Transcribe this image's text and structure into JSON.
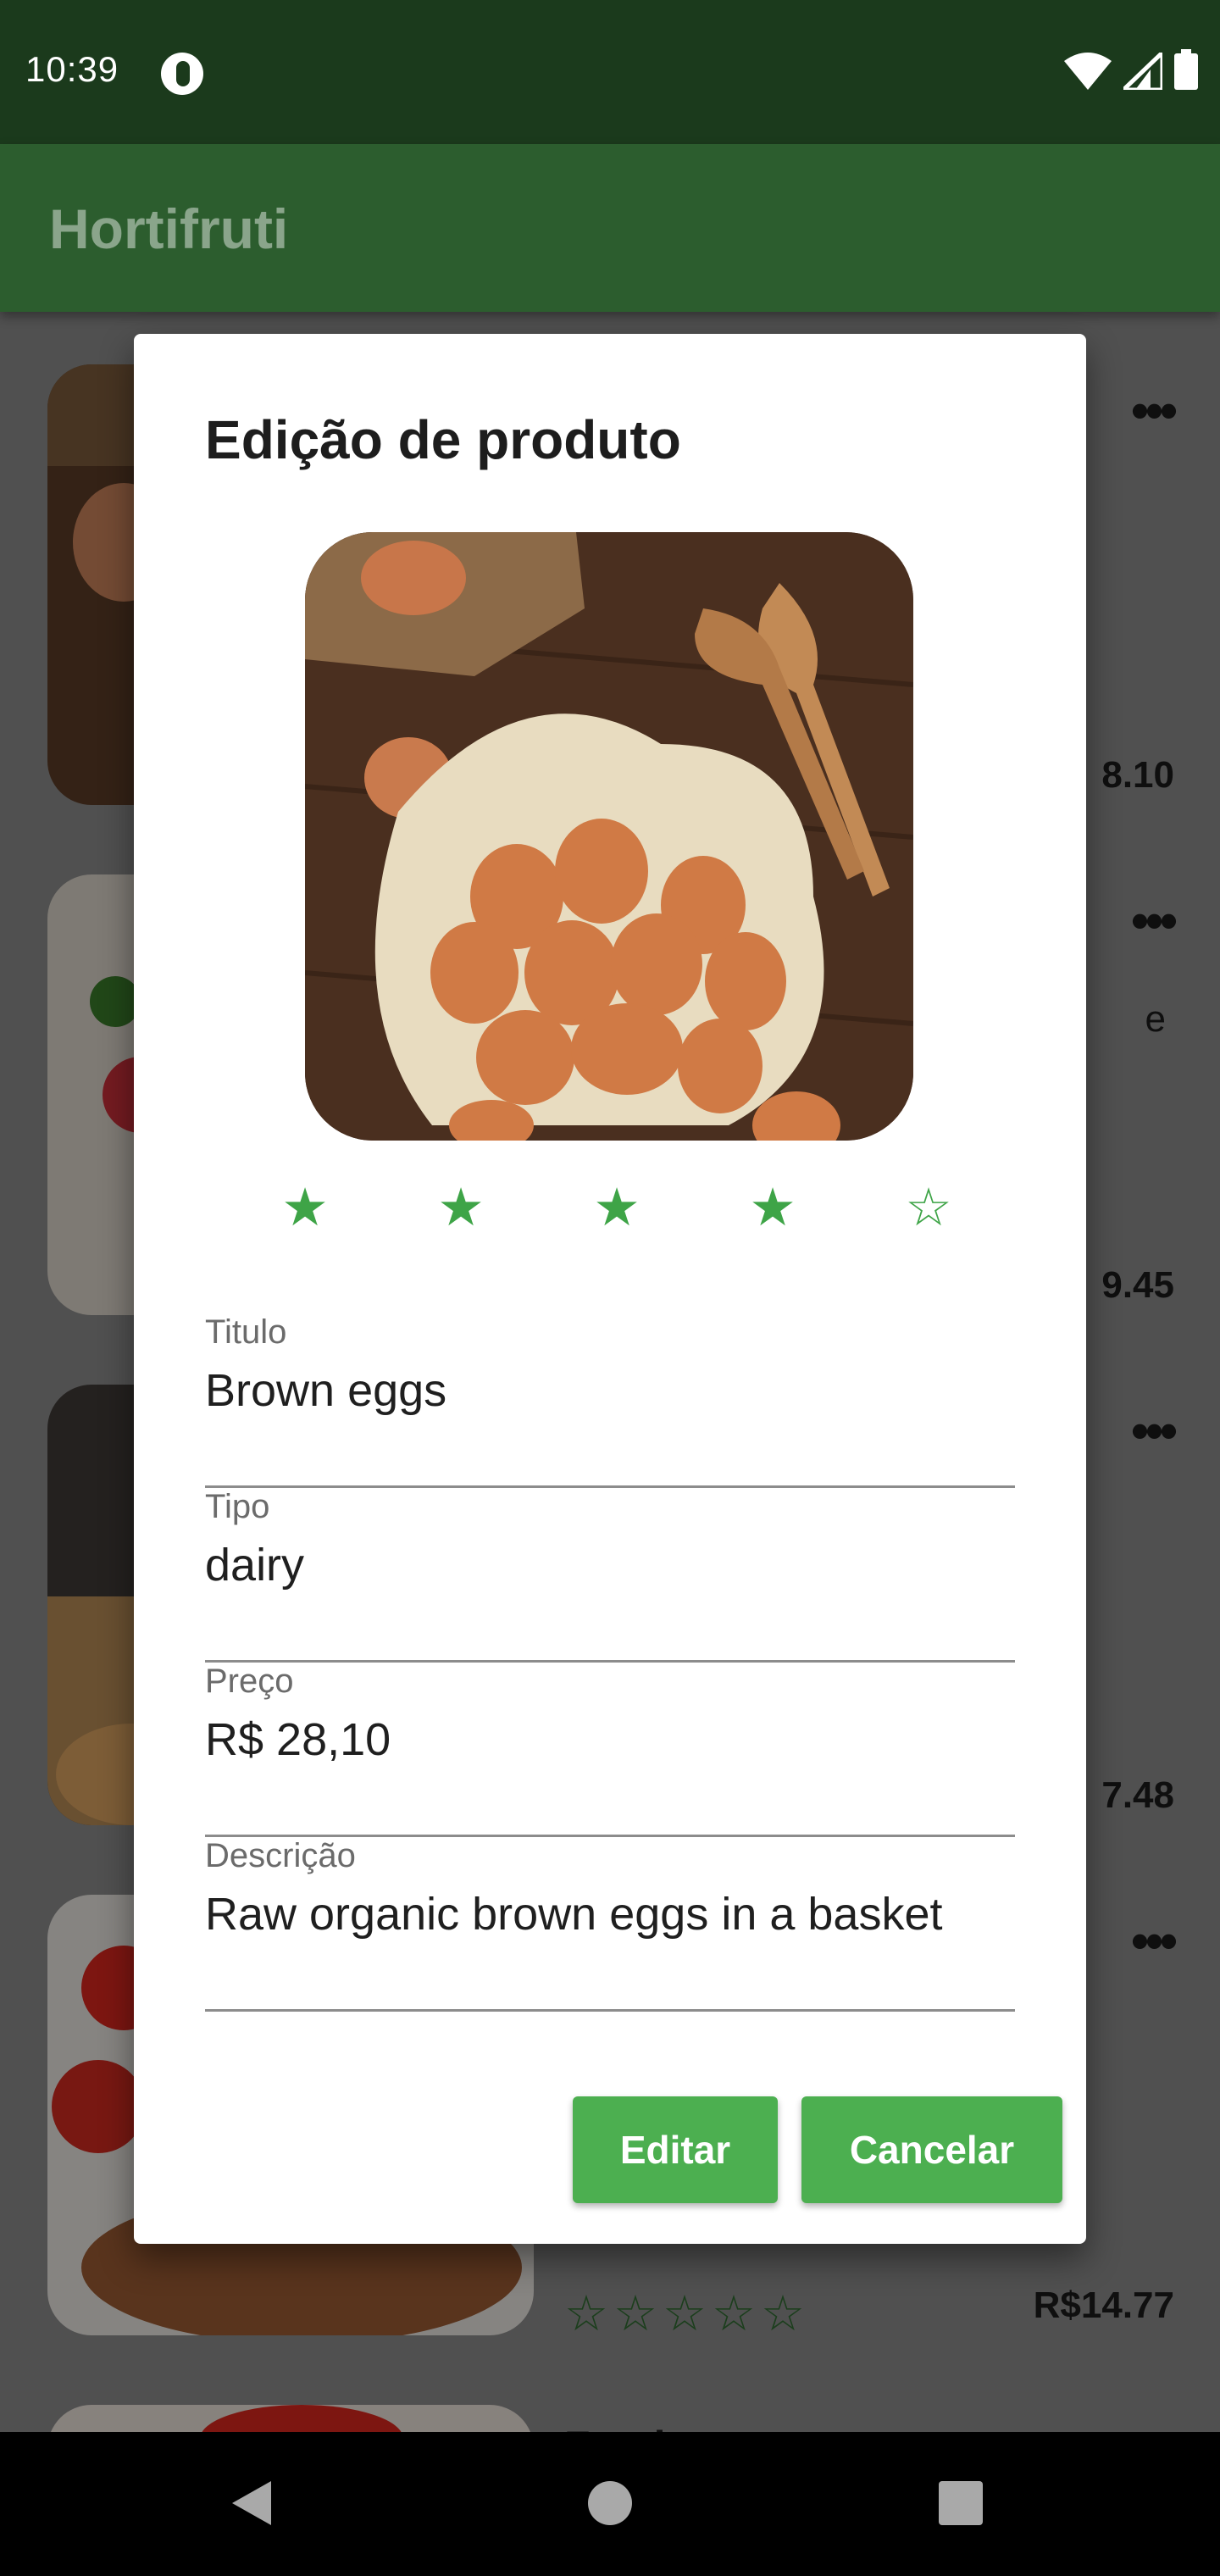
{
  "status_bar": {
    "time": "10:39"
  },
  "app_bar": {
    "title": "Hortifruti"
  },
  "list": {
    "cards": [
      {
        "price": "8.10"
      },
      {
        "price": "9.45",
        "extra": "e"
      },
      {
        "price": "7.48"
      },
      {
        "price": "R$14.77",
        "stars": "☆☆☆☆☆"
      },
      {
        "title": "Fresh tomato"
      }
    ]
  },
  "dialog": {
    "title": "Edição de produto",
    "rating": {
      "value": 4,
      "max": 5
    },
    "fields": {
      "titulo": {
        "label": "Titulo",
        "value": "Brown eggs"
      },
      "tipo": {
        "label": "Tipo",
        "value": "dairy"
      },
      "preco": {
        "label": "Preço",
        "value": "R$ 28,10"
      },
      "descricao": {
        "label": "Descrição",
        "value": "Raw organic brown eggs in a basket"
      }
    },
    "buttons": {
      "edit": "Editar",
      "cancel": "Cancelar"
    }
  },
  "colors": {
    "accent": "#4caf50",
    "app_bar": "#2c5d2e",
    "status_bar": "#1b3a1c"
  }
}
